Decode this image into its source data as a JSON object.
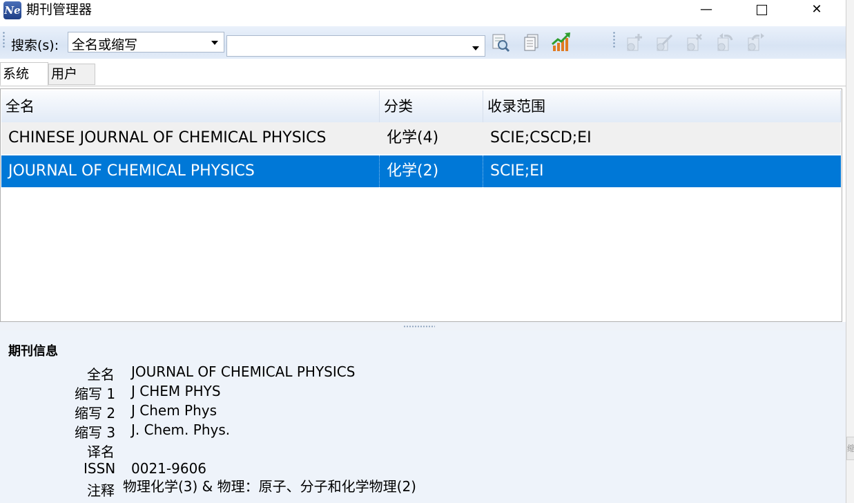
{
  "window": {
    "title": "期刊管理器",
    "app_icon_text": "Ne",
    "minimize_symbol": "—",
    "close_symbol": "✕"
  },
  "toolbar": {
    "search_label": "搜索(s):",
    "search_type_value": "全名或缩写",
    "search_text_value": "",
    "icons": [
      "find-icon",
      "records-icon",
      "chart-trend-icon",
      "add-gear-icon",
      "edit-gear-icon",
      "delete-gear-icon",
      "undo-gear-icon",
      "redo-gear-icon"
    ]
  },
  "tabs": [
    {
      "label": "系统",
      "active": true
    },
    {
      "label": "用户",
      "active": false
    }
  ],
  "grid": {
    "columns": [
      "全名",
      "分类",
      "收录范围"
    ],
    "rows": [
      {
        "full_name": "CHINESE JOURNAL OF CHEMICAL PHYSICS",
        "category": "化学(4)",
        "coverage": "SCIE;CSCD;EI",
        "selected": false
      },
      {
        "full_name": "JOURNAL OF CHEMICAL PHYSICS",
        "category": "化学(2)",
        "coverage": "SCIE;EI",
        "selected": true
      }
    ]
  },
  "info": {
    "title": "期刊信息",
    "fields": [
      {
        "label": "全名",
        "value": "JOURNAL OF CHEMICAL PHYSICS"
      },
      {
        "label": "缩写 1",
        "value": "J CHEM PHYS"
      },
      {
        "label": "缩写 2",
        "value": "J Chem Phys"
      },
      {
        "label": "缩写 3",
        "value": "J. Chem. Phys."
      },
      {
        "label": "译名",
        "value": ""
      },
      {
        "label": "ISSN",
        "value": "0021-9606"
      },
      {
        "label": "注释",
        "value": "物理化学(3) & 物理：原子、分子和化学物理(2)"
      }
    ]
  },
  "colors": {
    "selection": "#0078d7",
    "toolbar_bg": "#dfe8f5",
    "info_bg": "#eef3fa"
  },
  "side_peek_text": "缩"
}
